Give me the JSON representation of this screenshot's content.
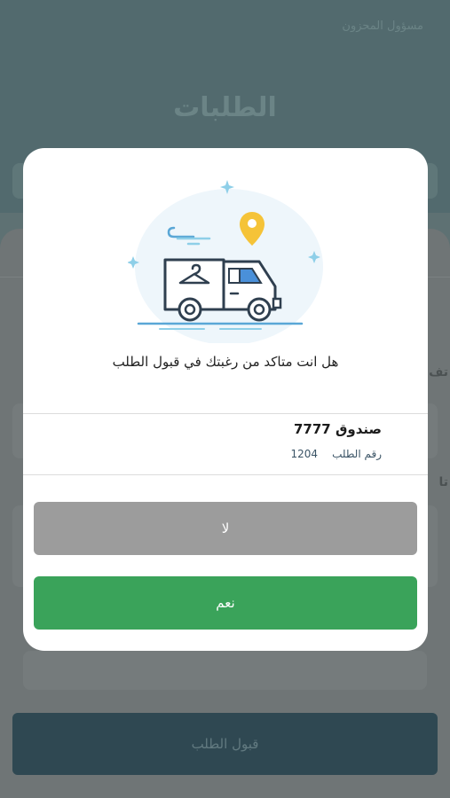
{
  "background": {
    "top_label": "مسؤول المحزون",
    "title": "الطلبات",
    "frag_1": "تف",
    "frag_2": "تا",
    "accept_button": "قبول الطلب"
  },
  "dialog": {
    "question": "هل انت متاكد من رغبتك في قبول الطلب",
    "box_name": "صندوق 7777",
    "order_label": "رقم الطلب",
    "order_number": "1204",
    "no_label": "لا",
    "yes_label": "نعم"
  },
  "colors": {
    "yes_button": "#3aa35a",
    "no_button": "#9c9c9c",
    "pin": "#f5c338",
    "truck_stroke": "#2f3f4f",
    "truck_window": "#4a90d9"
  },
  "icons": {
    "illustration": "delivery-truck-illustration",
    "pin": "location-pin-icon"
  }
}
